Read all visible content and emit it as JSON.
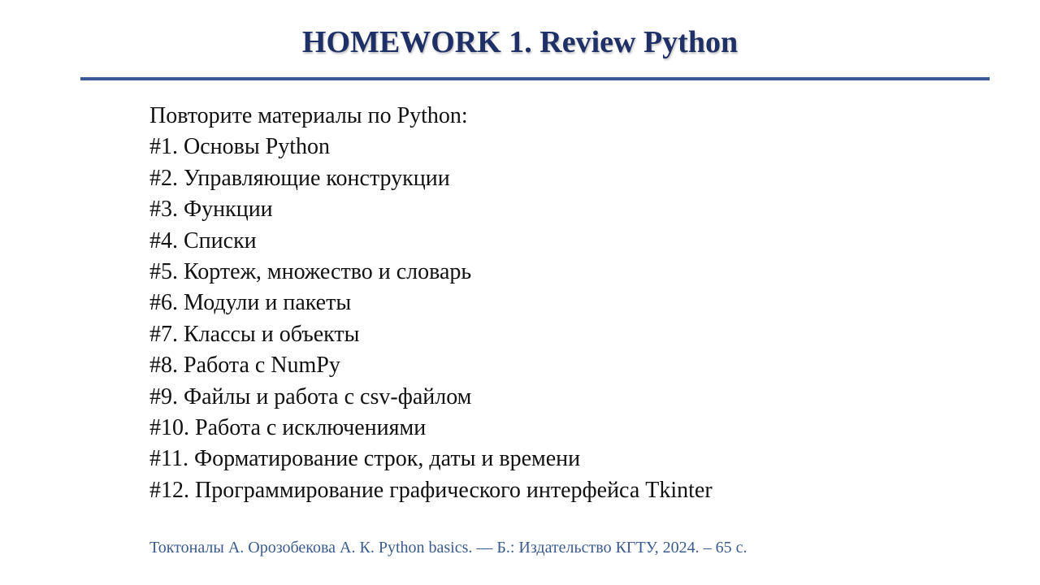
{
  "slide": {
    "title": "HOMEWORK 1. Review Python",
    "intro": "Повторите материалы по Python:",
    "items": [
      "#1. Основы Python",
      "#2. Управляющие конструкции",
      "#3. Функции",
      "#4. Списки",
      "#5. Кортеж, множество и словарь",
      "#6. Модули и пакеты",
      "#7. Классы и объекты",
      "#8. Работа с NumPy",
      "#9. Файлы и работа с csv-файлом",
      "#10. Работа с исключениями",
      "#11. Форматирование строк, даты и времени",
      "#12. Программирование графического интерфейса Tkinter"
    ],
    "reference": "Токтоналы А. Орозобекова А. К. Python basics. — Б.: Издательство КГТУ, 2024. – 65 с."
  },
  "colors": {
    "title": "#1f3067",
    "rule": "#3a5a96",
    "body_text": "#111111",
    "reference": "#3b5b8c",
    "background": "#ffffff"
  }
}
